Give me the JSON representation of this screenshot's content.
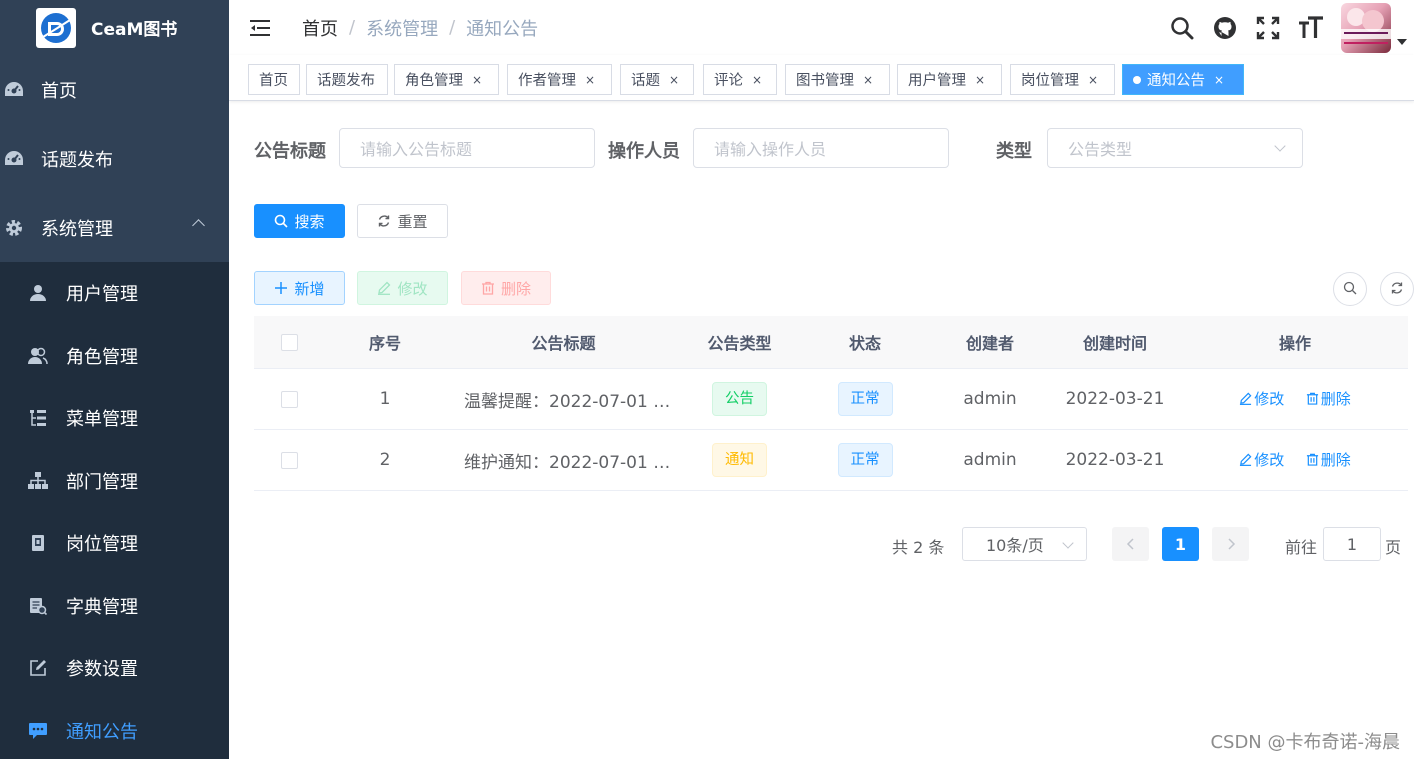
{
  "app": {
    "title": "CeaM图书"
  },
  "sidebar": {
    "top_items": [
      {
        "label": "首页",
        "icon": "dashboard-icon"
      },
      {
        "label": "话题发布",
        "icon": "dashboard-icon"
      },
      {
        "label": "系统管理",
        "icon": "gear-icon",
        "expanded": true
      }
    ],
    "sub_items": [
      {
        "label": "用户管理",
        "icon": "user-icon"
      },
      {
        "label": "角色管理",
        "icon": "peoples-icon"
      },
      {
        "label": "菜单管理",
        "icon": "tree-table-icon"
      },
      {
        "label": "部门管理",
        "icon": "tree-icon"
      },
      {
        "label": "岗位管理",
        "icon": "post-icon"
      },
      {
        "label": "字典管理",
        "icon": "dict-icon"
      },
      {
        "label": "参数设置",
        "icon": "edit-icon"
      },
      {
        "label": "通知公告",
        "icon": "message-icon",
        "active": true
      }
    ]
  },
  "breadcrumb": {
    "home": "首页",
    "sep": "/",
    "level1": "系统管理",
    "level2": "通知公告"
  },
  "tags": [
    {
      "label": "首页",
      "closable": false
    },
    {
      "label": "话题发布",
      "closable": false
    },
    {
      "label": "角色管理",
      "closable": true
    },
    {
      "label": "作者管理",
      "closable": true
    },
    {
      "label": "话题",
      "closable": true
    },
    {
      "label": "评论",
      "closable": true
    },
    {
      "label": "图书管理",
      "closable": true
    },
    {
      "label": "用户管理",
      "closable": true
    },
    {
      "label": "岗位管理",
      "closable": true
    },
    {
      "label": "通知公告",
      "closable": true,
      "active": true
    }
  ],
  "tag_close": "×",
  "search": {
    "title_label": "公告标题",
    "title_placeholder": "请输入公告标题",
    "operator_label": "操作人员",
    "operator_placeholder": "请输入操作人员",
    "type_label": "类型",
    "type_placeholder": "公告类型",
    "search_btn": "搜索",
    "reset_btn": "重置"
  },
  "toolbar": {
    "add": "新增",
    "edit": "修改",
    "delete": "删除"
  },
  "table": {
    "headers": [
      "序号",
      "公告标题",
      "公告类型",
      "状态",
      "创建者",
      "创建时间",
      "操作"
    ],
    "rows": [
      {
        "id": "1",
        "title": "温馨提醒：2022-07-01 …",
        "type": "公告",
        "type_style": "success",
        "status": "正常",
        "creator": "admin",
        "created": "2022-03-21",
        "edit": "修改",
        "delete": "删除"
      },
      {
        "id": "2",
        "title": "维护通知：2022-07-01 …",
        "type": "通知",
        "type_style": "warning",
        "status": "正常",
        "creator": "admin",
        "created": "2022-03-21",
        "edit": "修改",
        "delete": "删除"
      }
    ]
  },
  "pagination": {
    "total": "共 2 条",
    "page_size": "10条/页",
    "current": "1",
    "goto_label": "前往",
    "goto_value": "1",
    "page_suffix": "页"
  },
  "watermark": "CSDN @卡布奇诺-海晨",
  "colors": {
    "primary": "#1890ff",
    "sidebar_bg": "#304156",
    "submenu_bg": "#1f2d3d",
    "active_menu": "#409eff"
  }
}
